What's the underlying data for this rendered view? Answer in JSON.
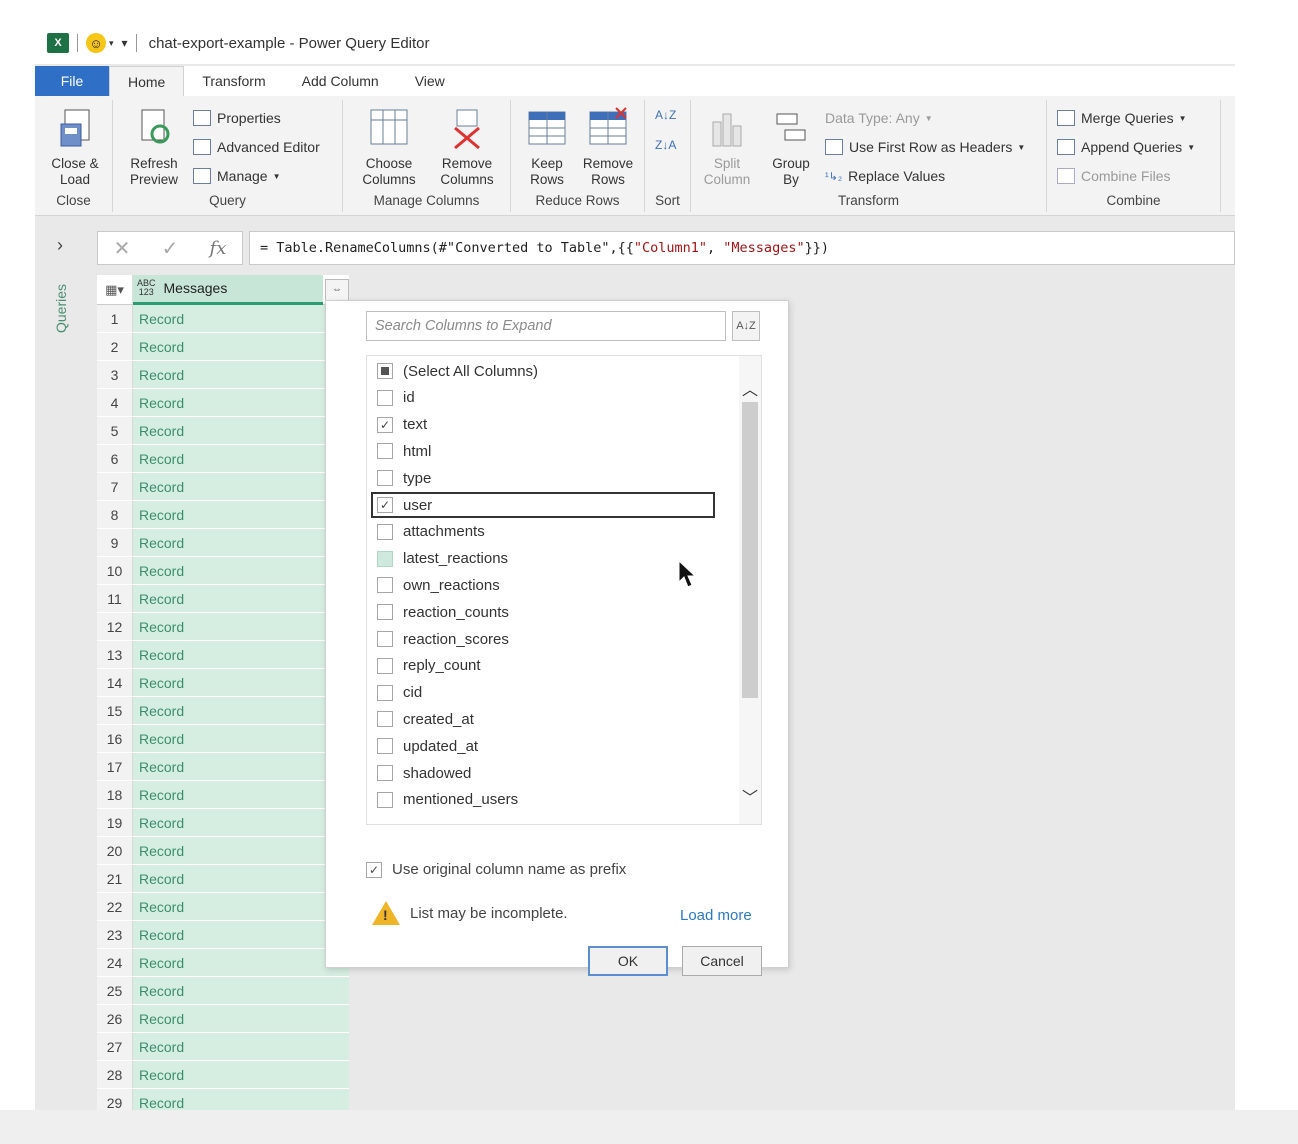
{
  "title_bar": {
    "app_icon": "X",
    "title": "chat-export-example - Power Query Editor"
  },
  "tabs": [
    "File",
    "Home",
    "Transform",
    "Add Column",
    "View"
  ],
  "ribbon": {
    "close": {
      "button": "Close &\nLoad",
      "label": "Close"
    },
    "query": {
      "refresh": "Refresh\nPreview",
      "properties": "Properties",
      "advanced_editor": "Advanced Editor",
      "manage": "Manage",
      "label": "Query"
    },
    "manage_columns": {
      "choose": "Choose\nColumns",
      "remove": "Remove\nColumns",
      "label": "Manage Columns"
    },
    "reduce_rows": {
      "keep": "Keep\nRows",
      "remove": "Remove\nRows",
      "label": "Reduce Rows"
    },
    "sort": {
      "label": "Sort"
    },
    "transform": {
      "split": "Split\nColumn",
      "group_by": "Group\nBy",
      "data_type": "Data Type: Any",
      "first_row": "Use First Row as Headers",
      "replace": "Replace Values",
      "label": "Transform"
    },
    "combine": {
      "merge": "Merge Queries",
      "append": "Append Queries",
      "combine_files": "Combine Files",
      "label": "Combine"
    }
  },
  "formula_bar": {
    "prefix": "= Table.RenameColumns(#\"Converted to Table\",{{",
    "arg1": "\"Column1\"",
    "sep": ", ",
    "arg2": "\"Messages\"",
    "suffix": "}})"
  },
  "queries_pane": {
    "label": "Queries"
  },
  "grid": {
    "type_badge_top": "ABC",
    "type_badge_bottom": "123",
    "column": "Messages",
    "rows": [
      {
        "n": "1",
        "v": "Record"
      },
      {
        "n": "2",
        "v": "Record"
      },
      {
        "n": "3",
        "v": "Record"
      },
      {
        "n": "4",
        "v": "Record"
      },
      {
        "n": "5",
        "v": "Record"
      },
      {
        "n": "6",
        "v": "Record"
      },
      {
        "n": "7",
        "v": "Record"
      },
      {
        "n": "8",
        "v": "Record"
      },
      {
        "n": "9",
        "v": "Record"
      },
      {
        "n": "10",
        "v": "Record"
      },
      {
        "n": "11",
        "v": "Record"
      },
      {
        "n": "12",
        "v": "Record"
      },
      {
        "n": "13",
        "v": "Record"
      },
      {
        "n": "14",
        "v": "Record"
      },
      {
        "n": "15",
        "v": "Record"
      },
      {
        "n": "16",
        "v": "Record"
      },
      {
        "n": "17",
        "v": "Record"
      },
      {
        "n": "18",
        "v": "Record"
      },
      {
        "n": "19",
        "v": "Record"
      },
      {
        "n": "20",
        "v": "Record"
      },
      {
        "n": "21",
        "v": "Record"
      },
      {
        "n": "22",
        "v": "Record"
      },
      {
        "n": "23",
        "v": "Record"
      },
      {
        "n": "24",
        "v": "Record"
      },
      {
        "n": "25",
        "v": "Record"
      },
      {
        "n": "26",
        "v": "Record"
      },
      {
        "n": "27",
        "v": "Record"
      },
      {
        "n": "28",
        "v": "Record"
      },
      {
        "n": "29",
        "v": "Record"
      }
    ]
  },
  "expand_dialog": {
    "search_placeholder": "Search Columns to Expand",
    "columns": [
      {
        "label": "(Select All Columns)",
        "state": "partial"
      },
      {
        "label": "id",
        "state": "unchecked"
      },
      {
        "label": "text",
        "state": "checked"
      },
      {
        "label": "html",
        "state": "unchecked"
      },
      {
        "label": "type",
        "state": "unchecked"
      },
      {
        "label": "user",
        "state": "checked",
        "focused": true
      },
      {
        "label": "attachments",
        "state": "unchecked"
      },
      {
        "label": "latest_reactions",
        "state": "hover"
      },
      {
        "label": "own_reactions",
        "state": "unchecked"
      },
      {
        "label": "reaction_counts",
        "state": "unchecked"
      },
      {
        "label": "reaction_scores",
        "state": "unchecked"
      },
      {
        "label": "reply_count",
        "state": "unchecked"
      },
      {
        "label": "cid",
        "state": "unchecked"
      },
      {
        "label": "created_at",
        "state": "unchecked"
      },
      {
        "label": "updated_at",
        "state": "unchecked"
      },
      {
        "label": "shadowed",
        "state": "unchecked"
      },
      {
        "label": "mentioned_users",
        "state": "unchecked"
      }
    ],
    "use_prefix": "Use original column name as prefix",
    "warning": "List may be incomplete.",
    "load_more": "Load more",
    "ok": "OK",
    "cancel": "Cancel"
  }
}
